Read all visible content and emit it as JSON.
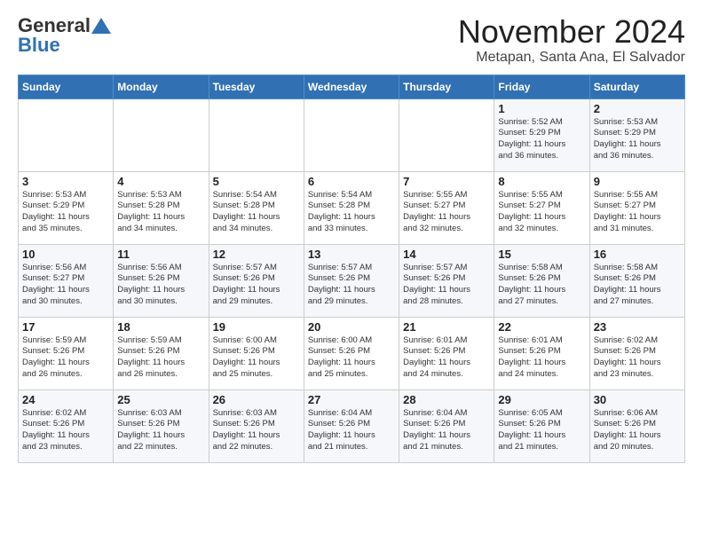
{
  "header": {
    "logo_general": "General",
    "logo_blue": "Blue",
    "month": "November 2024",
    "location": "Metapan, Santa Ana, El Salvador"
  },
  "days_of_week": [
    "Sunday",
    "Monday",
    "Tuesday",
    "Wednesday",
    "Thursday",
    "Friday",
    "Saturday"
  ],
  "weeks": [
    [
      {
        "day": "",
        "info": ""
      },
      {
        "day": "",
        "info": ""
      },
      {
        "day": "",
        "info": ""
      },
      {
        "day": "",
        "info": ""
      },
      {
        "day": "",
        "info": ""
      },
      {
        "day": "1",
        "info": "Sunrise: 5:52 AM\nSunset: 5:29 PM\nDaylight: 11 hours\nand 36 minutes."
      },
      {
        "day": "2",
        "info": "Sunrise: 5:53 AM\nSunset: 5:29 PM\nDaylight: 11 hours\nand 36 minutes."
      }
    ],
    [
      {
        "day": "3",
        "info": "Sunrise: 5:53 AM\nSunset: 5:29 PM\nDaylight: 11 hours\nand 35 minutes."
      },
      {
        "day": "4",
        "info": "Sunrise: 5:53 AM\nSunset: 5:28 PM\nDaylight: 11 hours\nand 34 minutes."
      },
      {
        "day": "5",
        "info": "Sunrise: 5:54 AM\nSunset: 5:28 PM\nDaylight: 11 hours\nand 34 minutes."
      },
      {
        "day": "6",
        "info": "Sunrise: 5:54 AM\nSunset: 5:28 PM\nDaylight: 11 hours\nand 33 minutes."
      },
      {
        "day": "7",
        "info": "Sunrise: 5:55 AM\nSunset: 5:27 PM\nDaylight: 11 hours\nand 32 minutes."
      },
      {
        "day": "8",
        "info": "Sunrise: 5:55 AM\nSunset: 5:27 PM\nDaylight: 11 hours\nand 32 minutes."
      },
      {
        "day": "9",
        "info": "Sunrise: 5:55 AM\nSunset: 5:27 PM\nDaylight: 11 hours\nand 31 minutes."
      }
    ],
    [
      {
        "day": "10",
        "info": "Sunrise: 5:56 AM\nSunset: 5:27 PM\nDaylight: 11 hours\nand 30 minutes."
      },
      {
        "day": "11",
        "info": "Sunrise: 5:56 AM\nSunset: 5:26 PM\nDaylight: 11 hours\nand 30 minutes."
      },
      {
        "day": "12",
        "info": "Sunrise: 5:57 AM\nSunset: 5:26 PM\nDaylight: 11 hours\nand 29 minutes."
      },
      {
        "day": "13",
        "info": "Sunrise: 5:57 AM\nSunset: 5:26 PM\nDaylight: 11 hours\nand 29 minutes."
      },
      {
        "day": "14",
        "info": "Sunrise: 5:57 AM\nSunset: 5:26 PM\nDaylight: 11 hours\nand 28 minutes."
      },
      {
        "day": "15",
        "info": "Sunrise: 5:58 AM\nSunset: 5:26 PM\nDaylight: 11 hours\nand 27 minutes."
      },
      {
        "day": "16",
        "info": "Sunrise: 5:58 AM\nSunset: 5:26 PM\nDaylight: 11 hours\nand 27 minutes."
      }
    ],
    [
      {
        "day": "17",
        "info": "Sunrise: 5:59 AM\nSunset: 5:26 PM\nDaylight: 11 hours\nand 26 minutes."
      },
      {
        "day": "18",
        "info": "Sunrise: 5:59 AM\nSunset: 5:26 PM\nDaylight: 11 hours\nand 26 minutes."
      },
      {
        "day": "19",
        "info": "Sunrise: 6:00 AM\nSunset: 5:26 PM\nDaylight: 11 hours\nand 25 minutes."
      },
      {
        "day": "20",
        "info": "Sunrise: 6:00 AM\nSunset: 5:26 PM\nDaylight: 11 hours\nand 25 minutes."
      },
      {
        "day": "21",
        "info": "Sunrise: 6:01 AM\nSunset: 5:26 PM\nDaylight: 11 hours\nand 24 minutes."
      },
      {
        "day": "22",
        "info": "Sunrise: 6:01 AM\nSunset: 5:26 PM\nDaylight: 11 hours\nand 24 minutes."
      },
      {
        "day": "23",
        "info": "Sunrise: 6:02 AM\nSunset: 5:26 PM\nDaylight: 11 hours\nand 23 minutes."
      }
    ],
    [
      {
        "day": "24",
        "info": "Sunrise: 6:02 AM\nSunset: 5:26 PM\nDaylight: 11 hours\nand 23 minutes."
      },
      {
        "day": "25",
        "info": "Sunrise: 6:03 AM\nSunset: 5:26 PM\nDaylight: 11 hours\nand 22 minutes."
      },
      {
        "day": "26",
        "info": "Sunrise: 6:03 AM\nSunset: 5:26 PM\nDaylight: 11 hours\nand 22 minutes."
      },
      {
        "day": "27",
        "info": "Sunrise: 6:04 AM\nSunset: 5:26 PM\nDaylight: 11 hours\nand 21 minutes."
      },
      {
        "day": "28",
        "info": "Sunrise: 6:04 AM\nSunset: 5:26 PM\nDaylight: 11 hours\nand 21 minutes."
      },
      {
        "day": "29",
        "info": "Sunrise: 6:05 AM\nSunset: 5:26 PM\nDaylight: 11 hours\nand 21 minutes."
      },
      {
        "day": "30",
        "info": "Sunrise: 6:06 AM\nSunset: 5:26 PM\nDaylight: 11 hours\nand 20 minutes."
      }
    ]
  ]
}
